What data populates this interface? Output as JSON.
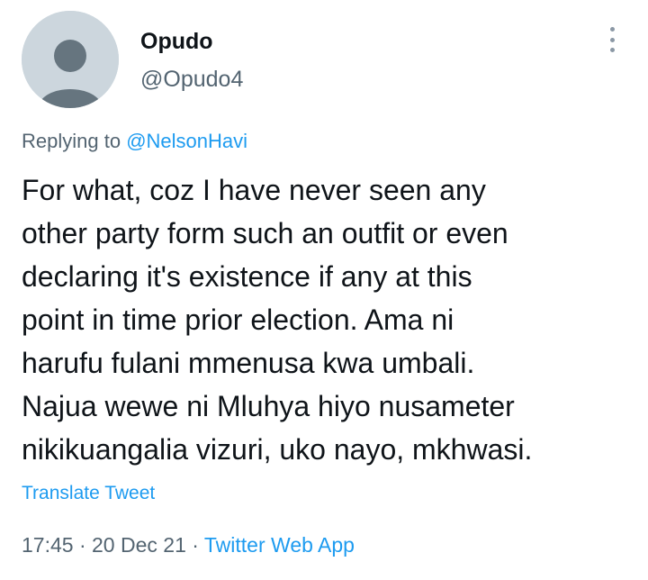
{
  "author": {
    "display_name": "Opudo",
    "handle": "@Opudo4"
  },
  "reply_context": {
    "prefix": "Replying to",
    "mention": "@NelsonHavi"
  },
  "tweet": {
    "lines": [
      "For what, coz I have never seen any",
      "other party form such an outfit or even",
      "declaring it's existence if any at this",
      "point in time prior election. Ama ni",
      "harufu fulani mmenusa kwa umbali.",
      "Najua wewe ni Mluhya hiyo nusameter",
      "nikikuangalia vizuri, uko nayo, mkhwasi."
    ]
  },
  "translate_label": "Translate Tweet",
  "meta": {
    "time": "17:45",
    "separator": " · ",
    "date": "20 Dec 21",
    "source": "Twitter Web App"
  },
  "icons": {
    "avatar": "default-avatar-icon",
    "menu": "more-options-icon"
  },
  "colors": {
    "link": "#1d9bf0",
    "secondary_text": "#536471",
    "primary_text": "#0f1419"
  }
}
